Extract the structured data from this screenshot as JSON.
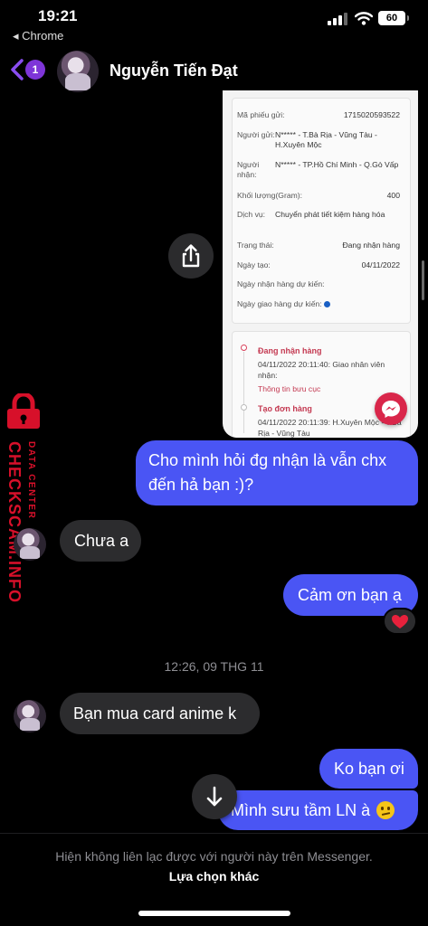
{
  "status_bar": {
    "time": "19:21",
    "back_app": "◂ Chrome",
    "battery": "60"
  },
  "header": {
    "unread_count": "1",
    "contact_name": "Nguyễn Tiến Đạt"
  },
  "shared_image": {
    "rows": [
      {
        "key": "Mã phiếu gửi:",
        "value": "1715020593522"
      },
      {
        "key": "Người gửi:",
        "value": "N***** - T.Bà Rịa - Vũng Tàu - H.Xuyên Mộc"
      },
      {
        "key": "Người nhận:",
        "value": "N***** - TP.Hồ Chí Minh - Q.Gò Vấp"
      },
      {
        "key": "Khối lượng(Gram):",
        "value": "400"
      },
      {
        "key": "Dịch vụ:",
        "value": "Chuyển phát tiết kiệm hàng hóa"
      },
      {
        "key": "Trạng thái:",
        "value": "Đang nhận hàng"
      },
      {
        "key": "Ngày tạo:",
        "value": "04/11/2022"
      },
      {
        "key": "Ngày nhận hàng dự kiến:",
        "value": ""
      },
      {
        "key": "Ngày giao hàng dự kiến:",
        "value": ""
      }
    ],
    "tracking": [
      {
        "title": "Đang nhận hàng",
        "text": "04/11/2022 20:11:40: Giao nhân viên nhận:",
        "link": "Thông tin bưu cục"
      },
      {
        "title": "Tạo đơn hàng",
        "text": "04/11/2022 20:11:39: H.Xuyên Mộc - T.Bà Rịa - Vũng Tàu",
        "link": ""
      }
    ]
  },
  "watermark": {
    "brand": "CHECKSCAM.INFO",
    "sub": "DATA CENTER"
  },
  "messages": {
    "m1": "Cho mình hỏi đg nhận là vẫn chx đến hả bạn :)?",
    "m2": "Chưa a",
    "m3": "Cảm ơn bạn ạ",
    "m3_reaction": "❤️",
    "timestamp": "12:26, 09 THG 11",
    "m4": "Bạn mua card anime k",
    "m5": "Ko bạn ơi",
    "m6": "Mình sưu tầm LN à"
  },
  "footer": {
    "note": "Hiện không liên lạc được với người này trên Messenger.",
    "link": "Lựa chọn khác"
  },
  "colors": {
    "outgoing": "#4a55f4",
    "incoming": "#2c2c2e",
    "accent": "#7e35d8",
    "watermark": "#d7102a"
  }
}
